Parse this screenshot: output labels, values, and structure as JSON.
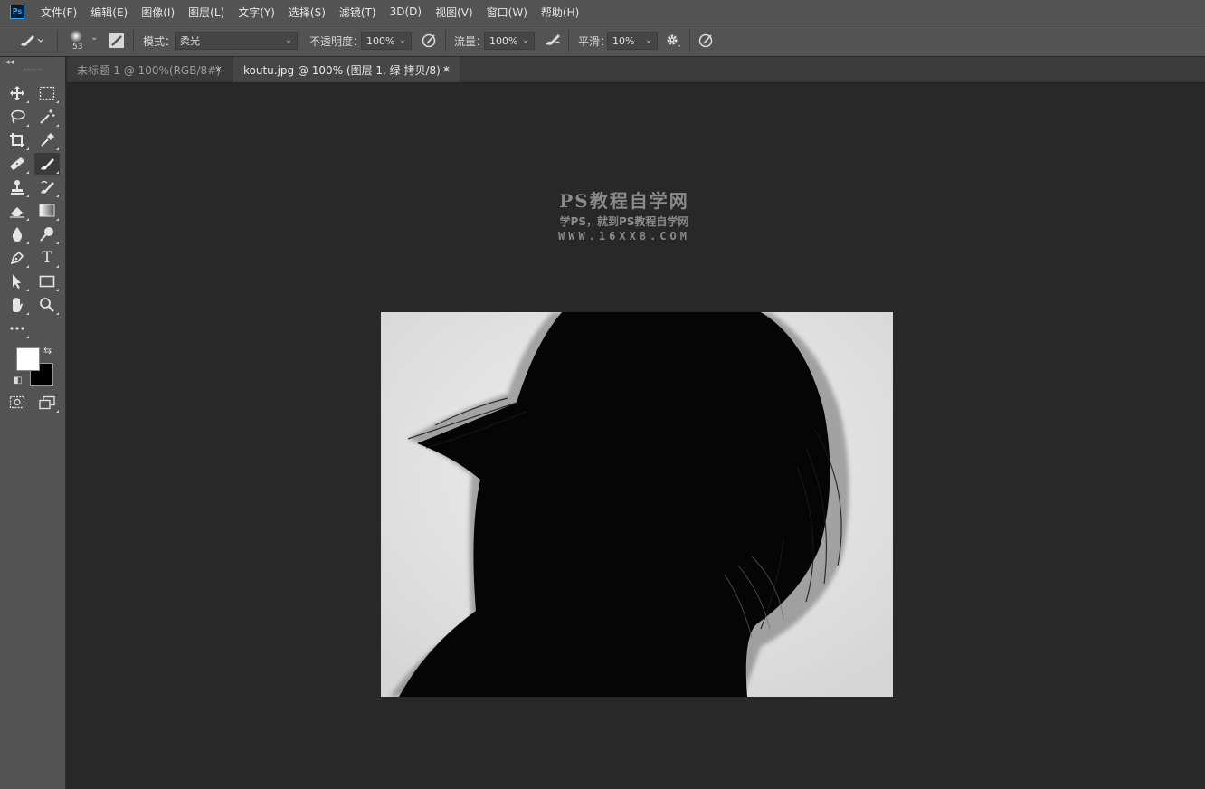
{
  "app": {
    "logo_text": "Ps",
    "menu": [
      "文件(F)",
      "编辑(E)",
      "图像(I)",
      "图层(L)",
      "文字(Y)",
      "选择(S)",
      "滤镜(T)",
      "3D(D)",
      "视图(V)",
      "窗口(W)",
      "帮助(H)"
    ]
  },
  "options": {
    "tool_icon": "brush-icon",
    "brush_size": "53",
    "mode_label": "模式：",
    "mode_value": "柔光",
    "opacity_label": "不透明度：",
    "opacity_value": "100%",
    "flow_label": "流量：",
    "flow_value": "100%",
    "smoothing_label": "平滑：",
    "smoothing_value": "10%"
  },
  "tabs": [
    {
      "label": "未标题-1 @ 100%(RGB/8#)",
      "active": false
    },
    {
      "label": "koutu.jpg @ 100% (图层 1, 绿 拷贝/8) *",
      "active": true
    }
  ],
  "tab_close_glyph": "×",
  "toolbar": {
    "tools": [
      {
        "name": "move-tool",
        "icon": "move-icon"
      },
      {
        "name": "marquee-tool",
        "icon": "rect-marquee-icon"
      },
      {
        "name": "lasso-tool",
        "icon": "lasso-icon"
      },
      {
        "name": "magic-wand-tool",
        "icon": "magic-wand-icon"
      },
      {
        "name": "crop-tool",
        "icon": "crop-icon"
      },
      {
        "name": "eyedropper-tool",
        "icon": "eyedropper-icon"
      },
      {
        "name": "healing-tool",
        "icon": "bandage-icon"
      },
      {
        "name": "brush-tool",
        "icon": "brush-icon",
        "active": true
      },
      {
        "name": "stamp-tool",
        "icon": "stamp-icon"
      },
      {
        "name": "history-brush-tool",
        "icon": "history-brush-icon"
      },
      {
        "name": "eraser-tool",
        "icon": "eraser-icon"
      },
      {
        "name": "gradient-tool",
        "icon": "gradient-icon"
      },
      {
        "name": "blur-tool",
        "icon": "drop-icon"
      },
      {
        "name": "dodge-tool",
        "icon": "dodge-icon"
      },
      {
        "name": "pen-tool",
        "icon": "pen-icon"
      },
      {
        "name": "type-tool",
        "icon": "type-icon",
        "glyph": "T"
      },
      {
        "name": "path-select-tool",
        "icon": "arrow-icon"
      },
      {
        "name": "rectangle-tool",
        "icon": "rectangle-icon"
      },
      {
        "name": "hand-tool",
        "icon": "hand-icon"
      },
      {
        "name": "zoom-tool",
        "icon": "zoom-icon"
      },
      {
        "name": "more-tools",
        "icon": "ellipsis-icon"
      }
    ],
    "foreground_color": "#ffffff",
    "background_color": "#000000"
  },
  "watermark": {
    "title": "PS教程自学网",
    "subtitle": "学PS，就到PS教程自学网",
    "url": "WWW.16XX8.COM"
  },
  "document": {
    "image_subject": "silhouette-hair",
    "background_color": "#e6e6e6"
  }
}
